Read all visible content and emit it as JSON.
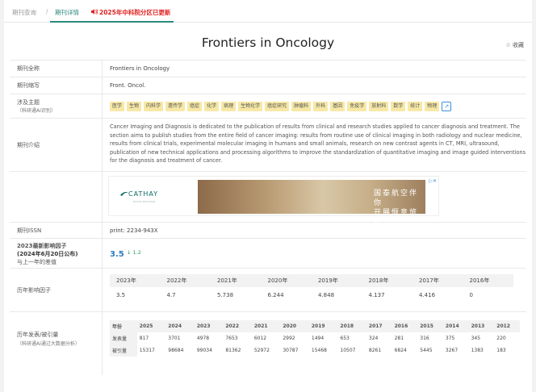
{
  "tabs": {
    "search": "期刊查询",
    "separator": "/",
    "detail": "期刊详情",
    "notice": "2025年中科院分区已更新"
  },
  "title": "Frontiers in Oncology",
  "collect_label": "收藏",
  "fields": {
    "full_name": {
      "label": "期刊全称",
      "value": "Frontiers in Oncology"
    },
    "abbr": {
      "label": "期刊缩写",
      "value": "Front. Oncol."
    },
    "topics": {
      "label": "涉及主题",
      "sublabel": "（科研通AI识别）",
      "tags": [
        "医学",
        "生物",
        "内科学",
        "遗传学",
        "癌症",
        "化学",
        "病理",
        "生物化学",
        "癌症研究",
        "肿瘤科",
        "外科",
        "基因",
        "免疫学",
        "放射科",
        "数学",
        "统计",
        "物理"
      ]
    },
    "intro": {
      "label": "期刊介绍",
      "text": "Cancer Imaging and Diagnosis is dedicated to the publication of results from clinical and research studies applied to cancer diagnosis and treatment. The section aims to publish studies from the entire field of cancer imaging: results from routine use of clinical imaging in both radiology and nuclear medicine, results from clinical trials, experimental molecular imaging in humans and small animals, research on new contrast agents in CT, MRI, ultrasound, publication of new technical applications and processing algorithms to improve the standardization of quantitative imaging and image guided interventions for the diagnosis and treatment of cancer."
    },
    "ad": {
      "brand": "CATHAY",
      "brand_sub": "MOVE BEYOND",
      "text_line1": "国泰航空伴你",
      "text_line2": "开展愜意旅程",
      "close": "▷✕"
    },
    "issn": {
      "label": "期刊ISSN",
      "value": "print: 2234-943X"
    },
    "impact": {
      "label_red": "2023最新影响因子",
      "label_bold": "(2024年6月20日公布)",
      "label_sub": "与上一年的差值",
      "value": "3.5",
      "delta": "↓ 1.2"
    },
    "history_if": {
      "label": "历年影响因子",
      "years": [
        "2023年",
        "2022年",
        "2021年",
        "2020年",
        "2019年",
        "2018年",
        "2017年",
        "2016年"
      ],
      "values": [
        "3.5",
        "4.7",
        "5.738",
        "6.244",
        "4.848",
        "4.137",
        "4.416",
        "0"
      ]
    },
    "pubs": {
      "label": "历年发表/被引量",
      "sublabel": "（科研通AI通过大数据分析）",
      "header": [
        "年份",
        "2025",
        "2024",
        "2023",
        "2022",
        "2021",
        "2020",
        "2019",
        "2018",
        "2017",
        "2016",
        "2015",
        "2014",
        "2013",
        "2012"
      ],
      "published_label": "发表量",
      "published": [
        "817",
        "3701",
        "4978",
        "7653",
        "6012",
        "2992",
        "1494",
        "653",
        "324",
        "281",
        "316",
        "375",
        "345",
        "220"
      ],
      "cited_label": "被引量",
      "cited": [
        "15317",
        "98684",
        "99034",
        "81362",
        "52972",
        "30787",
        "15468",
        "10507",
        "8261",
        "6824",
        "5445",
        "3267",
        "1383",
        "183"
      ]
    }
  }
}
